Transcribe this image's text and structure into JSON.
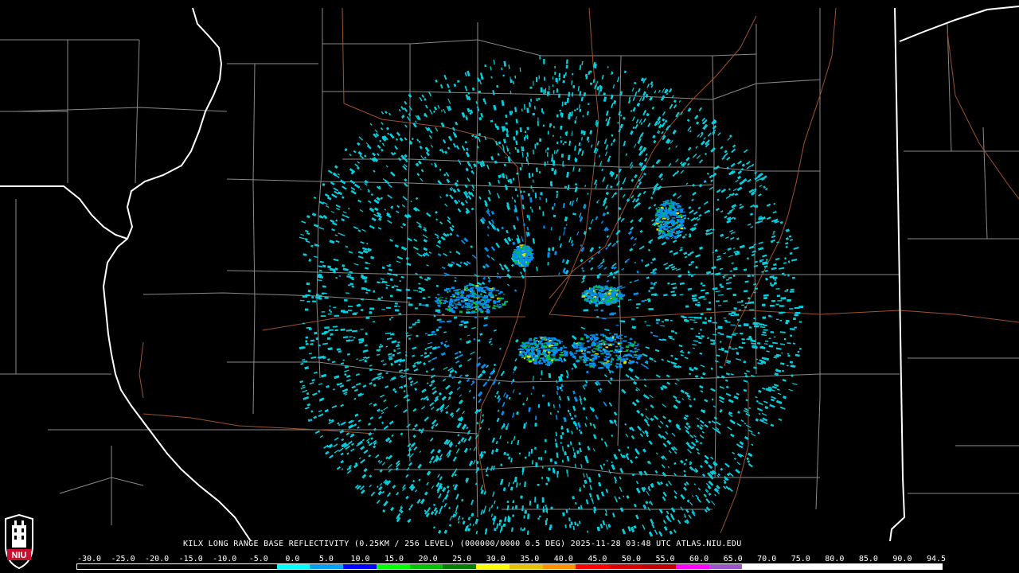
{
  "caption": "KILX LONG RANGE BASE REFLECTIVITY (0.25KM / 256 LEVEL) (000000/0000 0.5 DEG) 2025-11-28 03:48 UTC  ATLAS.NIU.EDU",
  "logo": {
    "text": "NIU",
    "icon": "niu-logo-icon"
  },
  "legend": {
    "labels": [
      "-30.0",
      "-25.0",
      "-20.0",
      "-15.0",
      "-10.0",
      "-5.0",
      "0.0",
      "5.0",
      "10.0",
      "15.0",
      "20.0",
      "25.0",
      "30.0",
      "35.0",
      "40.0",
      "45.0",
      "50.0",
      "55.0",
      "60.0",
      "65.0",
      "70.0",
      "75.0",
      "80.0",
      "85.0",
      "90.0",
      "94.5"
    ],
    "colors": [
      "#000000",
      "#000000",
      "#000000",
      "#000000",
      "#000000",
      "#000000",
      "#00ffff",
      "#00a0f0",
      "#0000ff",
      "#00ff00",
      "#00c000",
      "#008000",
      "#ffff00",
      "#e7c000",
      "#ff9000",
      "#ff0000",
      "#d60000",
      "#c00000",
      "#ff00ff",
      "#9955c9",
      "#ffffff",
      "#ffffff",
      "#ffffff",
      "#ffffff",
      "#ffffff",
      "#ffffff"
    ]
  },
  "colors": {
    "background": "#000000",
    "state_border": "#ffffff",
    "county_border": "#9a9a9a",
    "highway": "#a0522d",
    "weak_echo": "#00d0e0",
    "medium_echo": "#0090f0",
    "strong_echo": "#00c040",
    "peak_echo": "#e0e000"
  }
}
